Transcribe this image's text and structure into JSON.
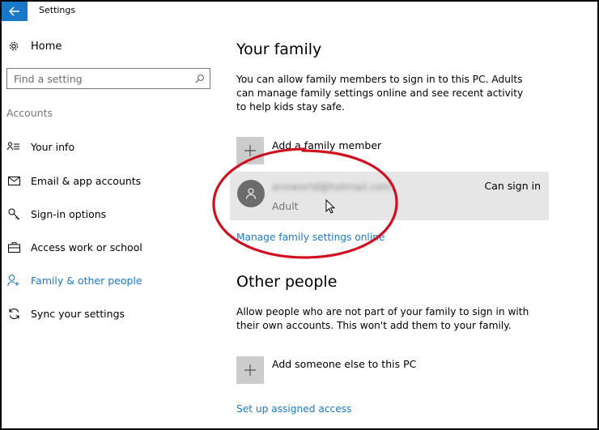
{
  "window": {
    "title": "Settings"
  },
  "sidebar": {
    "home_label": "Home",
    "search_placeholder": "Find a setting",
    "section_label": "Accounts",
    "items": [
      {
        "label": "Your info",
        "icon": "person-list-icon"
      },
      {
        "label": "Email & app accounts",
        "icon": "envelope-icon"
      },
      {
        "label": "Sign-in options",
        "icon": "key-icon"
      },
      {
        "label": "Access work or school",
        "icon": "briefcase-icon"
      },
      {
        "label": "Family & other people",
        "icon": "person-add-icon",
        "active": true
      },
      {
        "label": "Sync your settings",
        "icon": "sync-icon"
      }
    ]
  },
  "family": {
    "heading": "Your family",
    "description": "You can allow family members to sign in to this PC. Adults can manage family settings online and see recent activity to help kids stay safe.",
    "add_label": "Add a family member",
    "member": {
      "email": "anoworld@hotmail.com",
      "role": "Adult",
      "status": "Can sign in"
    },
    "manage_link": "Manage family settings online"
  },
  "other": {
    "heading": "Other people",
    "description": "Allow people who are not part of your family to sign in with their own accounts. This won't add them to your family.",
    "add_label": "Add someone else to this PC",
    "assigned_link": "Set up assigned access"
  },
  "colors": {
    "accent": "#1979c8",
    "annotation": "#d01020"
  }
}
